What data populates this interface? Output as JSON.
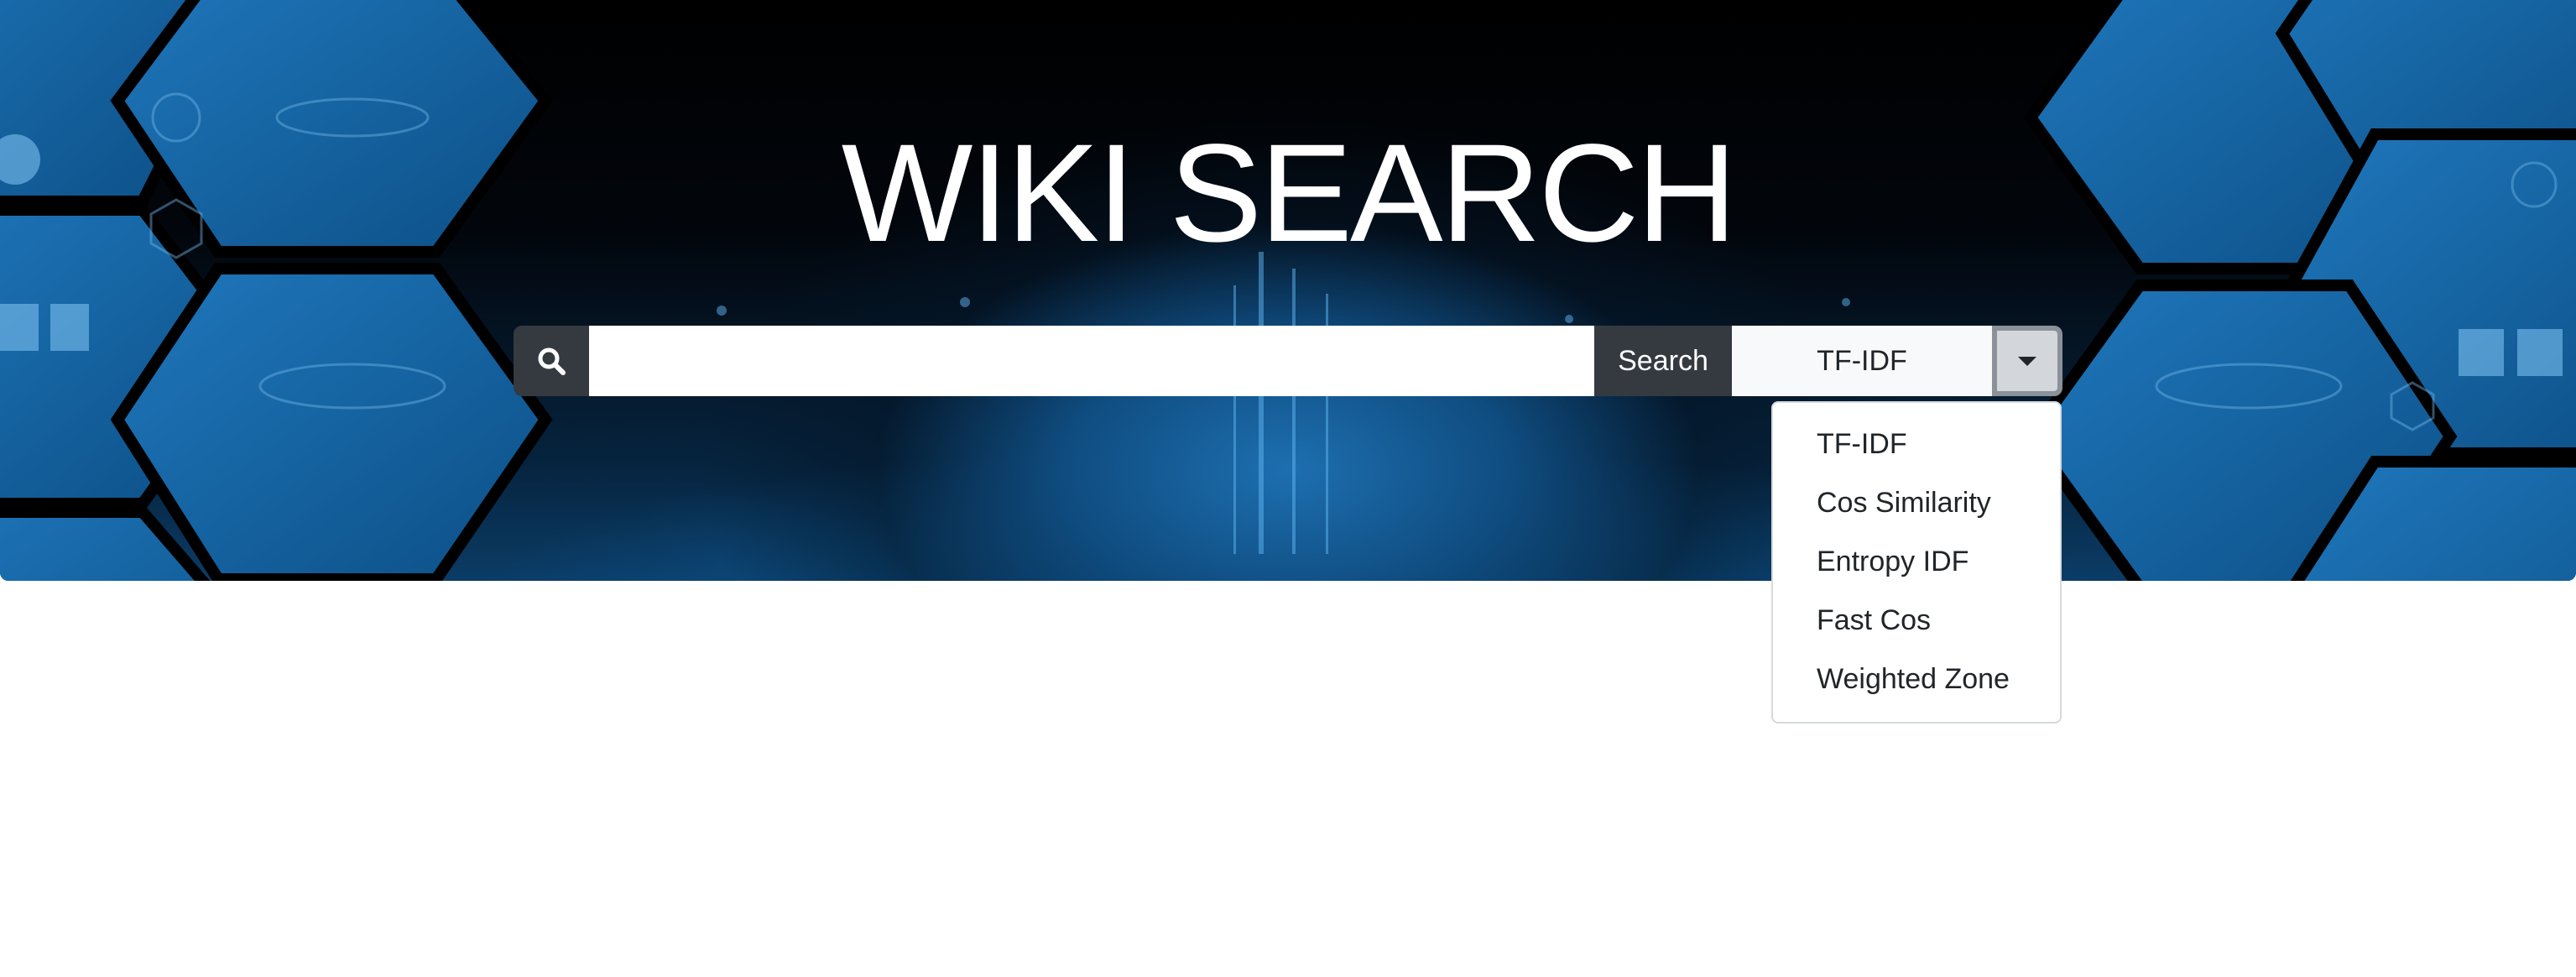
{
  "page": {
    "title": "WIKI SEARCH"
  },
  "search": {
    "icon": "search-icon",
    "input_value": "",
    "placeholder": "",
    "button_label": "Search",
    "selected_algorithm": "TF-IDF",
    "toggle_icon": "caret-down-icon"
  },
  "dropdown": {
    "open": true,
    "options": [
      "TF-IDF",
      "Cos Similarity",
      "Entropy IDF",
      "Fast Cos",
      "Weighted Zone"
    ]
  },
  "colors": {
    "hero_dark": "#000000",
    "hero_blue": "#1d6fb0",
    "button_dark": "#343a40",
    "select_bg": "#f8f9fa"
  }
}
